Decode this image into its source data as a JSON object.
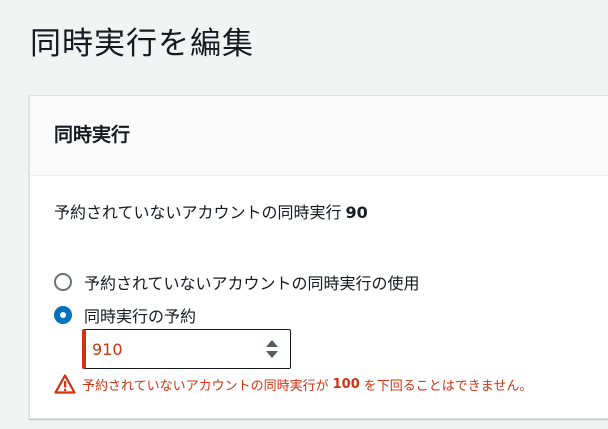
{
  "page": {
    "title": "同時実行を編集"
  },
  "panel": {
    "header": "同時実行",
    "unreserved_label": "予約されていないアカウントの同時実行",
    "unreserved_value": "90",
    "options": [
      {
        "label": "予約されていないアカウントの同時実行の使用",
        "selected": false
      },
      {
        "label": "同時実行の予約",
        "selected": true
      }
    ],
    "reserved_input": {
      "value": "910"
    },
    "error": {
      "prefix": "予約されていないアカウントの同時実行が",
      "value": "100",
      "suffix": "を下回ることはできません。",
      "icon": "warning-icon"
    }
  },
  "colors": {
    "accent": "#0073bb",
    "error": "#d13212",
    "background": "#f2f3f3"
  }
}
